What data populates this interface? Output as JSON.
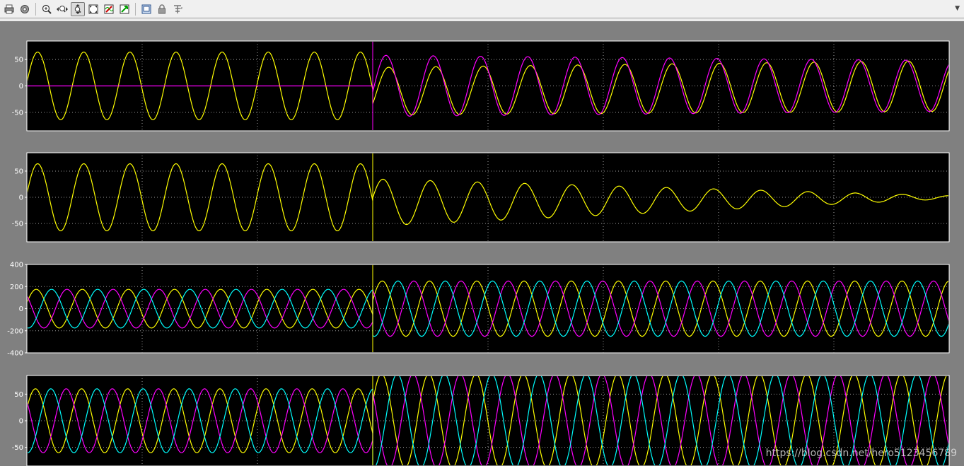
{
  "toolbar": {
    "buttons": [
      {
        "name": "print-icon"
      },
      {
        "name": "parameters-icon"
      },
      {
        "name": "zoom-in-icon"
      },
      {
        "name": "zoom-x-icon"
      },
      {
        "name": "zoom-y-icon",
        "active": true
      },
      {
        "name": "autoscale-icon"
      },
      {
        "name": "save-axes-settings-icon"
      },
      {
        "name": "restore-axes-settings-icon"
      },
      {
        "name": "floating-scope-icon"
      },
      {
        "name": "lock-axes-icon"
      },
      {
        "name": "signal-selection-icon"
      }
    ]
  },
  "watermark": "https://blog.csdn.net/hero5123456789",
  "colors": {
    "background": "#808080",
    "axes": "#000000",
    "yellow": "#ffff00",
    "magenta": "#ff00ff",
    "cyan": "#00ffff"
  },
  "chart_data": [
    {
      "type": "line",
      "ylim": [
        -85,
        85
      ],
      "yticks": [
        -50,
        0,
        50
      ],
      "ytick_labels": [
        "-50",
        "0",
        "50"
      ],
      "xlim": [
        0,
        1
      ],
      "x_gridlines": 8,
      "grid": true,
      "event_x": 0.375,
      "series": [
        {
          "color": "#ffff00",
          "segments": [
            {
              "x0": 0,
              "x1": 0.375,
              "amp0": 64,
              "amp1": 64,
              "cycles": 7.5,
              "phase": 0.1,
              "offset0": 0,
              "offset1": 0
            },
            {
              "x0": 0.375,
              "x1": 1,
              "amp0": 45,
              "amp1": 48,
              "cycles": 12.2,
              "phase": -0.55,
              "offset0": -10,
              "offset1": 0
            }
          ]
        },
        {
          "color": "#ff00ff",
          "segments": [
            {
              "x0": 0,
              "x1": 0.375,
              "amp0": 0,
              "amp1": 0,
              "cycles": 0,
              "phase": 0,
              "offset0": 0,
              "offset1": 0
            },
            {
              "x0": 0.375,
              "x1": 1,
              "amp0": 58,
              "amp1": 48,
              "cycles": 12.2,
              "phase": -0.2,
              "offset0": 0,
              "offset1": 0
            }
          ]
        }
      ]
    },
    {
      "type": "line",
      "ylim": [
        -85,
        85
      ],
      "yticks": [
        -50,
        0,
        50
      ],
      "ytick_labels": [
        "-50",
        "0",
        "50"
      ],
      "xlim": [
        0,
        1
      ],
      "x_gridlines": 8,
      "grid": true,
      "event_x": 0.375,
      "series": [
        {
          "color": "#ffff00",
          "segments": [
            {
              "x0": 0,
              "x1": 0.375,
              "amp0": 64,
              "amp1": 64,
              "cycles": 7.5,
              "phase": 0.1,
              "offset0": 0,
              "offset1": 0
            },
            {
              "x0": 0.375,
              "x1": 1,
              "amp0": 45,
              "amp1": 3,
              "cycles": 12.2,
              "phase": 0.2,
              "offset0": -10,
              "offset1": 0
            }
          ]
        }
      ]
    },
    {
      "type": "line",
      "ylim": [
        -400,
        400
      ],
      "yticks": [
        -400,
        -200,
        0,
        200,
        400
      ],
      "ytick_labels": [
        "-400",
        "-200",
        "0",
        "200",
        "400"
      ],
      "xlim": [
        0,
        1
      ],
      "x_gridlines": 8,
      "grid": true,
      "event_x": 0.375,
      "series": [
        {
          "color": "#ffff00",
          "segments": [
            {
              "x0": 0,
              "x1": 0.375,
              "amp0": 175,
              "amp1": 175,
              "cycles": 7.5,
              "phase": 0.3,
              "offset0": 0,
              "offset1": 0
            },
            {
              "x0": 0.375,
              "x1": 1,
              "amp0": 250,
              "amp1": 250,
              "cycles": 12.2,
              "phase": 0.3,
              "offset0": 0,
              "offset1": 0
            }
          ]
        },
        {
          "color": "#ff00ff",
          "segments": [
            {
              "x0": 0,
              "x1": 0.375,
              "amp0": 175,
              "amp1": 175,
              "cycles": 7.5,
              "phase": 2.39,
              "offset0": 0,
              "offset1": 0
            },
            {
              "x0": 0.375,
              "x1": 1,
              "amp0": 250,
              "amp1": 250,
              "cycles": 12.2,
              "phase": 2.39,
              "offset0": 0,
              "offset1": 0
            }
          ]
        },
        {
          "color": "#00ffff",
          "segments": [
            {
              "x0": 0,
              "x1": 0.375,
              "amp0": 175,
              "amp1": 175,
              "cycles": 7.5,
              "phase": 4.49,
              "offset0": 0,
              "offset1": 0
            },
            {
              "x0": 0.375,
              "x1": 1,
              "amp0": 250,
              "amp1": 250,
              "cycles": 12.2,
              "phase": 4.49,
              "offset0": 0,
              "offset1": 0
            }
          ]
        }
      ]
    },
    {
      "type": "line",
      "ylim": [
        -85,
        85
      ],
      "yticks": [
        -50,
        0,
        50
      ],
      "ytick_labels": [
        "-50",
        "0",
        "50"
      ],
      "xlim": [
        0,
        1
      ],
      "x_gridlines": 8,
      "grid": true,
      "event_x": 0.375,
      "series": [
        {
          "color": "#ffff00",
          "segments": [
            {
              "x0": 0,
              "x1": 0.375,
              "amp0": 60,
              "amp1": 60,
              "cycles": 7.5,
              "phase": 0.4,
              "offset0": 0,
              "offset1": 0
            },
            {
              "x0": 0.375,
              "x1": 1,
              "amp0": 88,
              "amp1": 88,
              "cycles": 12.2,
              "phase": 0.4,
              "offset0": 0,
              "offset1": 0
            }
          ]
        },
        {
          "color": "#ff00ff",
          "segments": [
            {
              "x0": 0,
              "x1": 0.375,
              "amp0": 60,
              "amp1": 60,
              "cycles": 7.5,
              "phase": 2.49,
              "offset0": 0,
              "offset1": 0
            },
            {
              "x0": 0.375,
              "x1": 1,
              "amp0": 88,
              "amp1": 88,
              "cycles": 12.2,
              "phase": 2.49,
              "offset0": 0,
              "offset1": 0
            }
          ]
        },
        {
          "color": "#00ffff",
          "segments": [
            {
              "x0": 0,
              "x1": 0.375,
              "amp0": 60,
              "amp1": 60,
              "cycles": 7.5,
              "phase": 4.59,
              "offset0": 0,
              "offset1": 0
            },
            {
              "x0": 0.375,
              "x1": 1,
              "amp0": 88,
              "amp1": 88,
              "cycles": 12.2,
              "phase": 4.59,
              "offset0": 0,
              "offset1": 0
            }
          ]
        }
      ]
    }
  ]
}
